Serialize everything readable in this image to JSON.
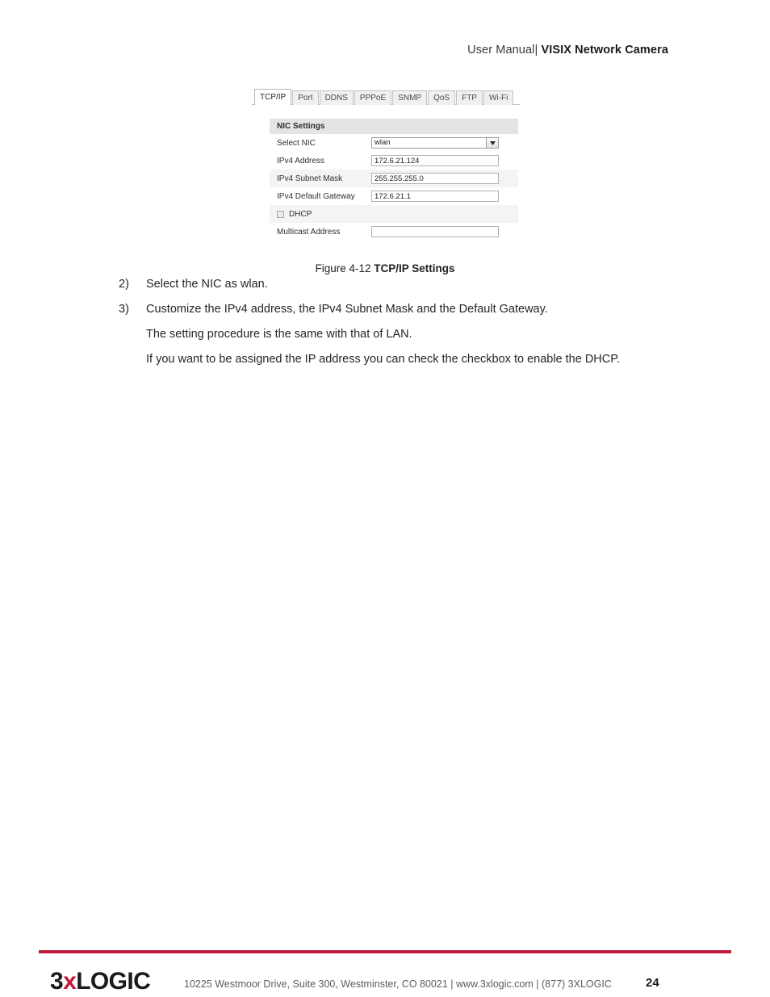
{
  "header": {
    "manual_label": "User Manual|",
    "product": "VISIX Network Camera"
  },
  "screenshot": {
    "tabs": [
      {
        "label": "TCP/IP",
        "active": true
      },
      {
        "label": "Port",
        "active": false
      },
      {
        "label": "DDNS",
        "active": false
      },
      {
        "label": "PPPoE",
        "active": false
      },
      {
        "label": "SNMP",
        "active": false
      },
      {
        "label": "QoS",
        "active": false
      },
      {
        "label": "FTP",
        "active": false
      },
      {
        "label": "Wi-Fi",
        "active": false
      }
    ],
    "panel_title": "NIC Settings",
    "fields": {
      "select_nic": {
        "label": "Select NIC",
        "value": "wlan"
      },
      "ipv4_address": {
        "label": "IPv4 Address",
        "value": "172.6.21.124"
      },
      "ipv4_subnet_mask": {
        "label": "IPv4 Subnet Mask",
        "value": "255.255.255.0"
      },
      "ipv4_default_gateway": {
        "label": "IPv4 Default Gateway",
        "value": "172.6.21.1"
      },
      "dhcp": {
        "label": "DHCP",
        "checked": false
      },
      "multicast_address": {
        "label": "Multicast Address",
        "value": ""
      }
    }
  },
  "figure": {
    "number": "Figure 4-12 ",
    "name": "TCP/IP Settings"
  },
  "steps": [
    {
      "num": "2)",
      "text": "Select the NIC as wlan."
    },
    {
      "num": "3)",
      "text": "Customize the IPv4 address, the IPv4 Subnet Mask and the Default Gateway."
    }
  ],
  "paragraphs": [
    "The setting procedure is the same with that of LAN.",
    "If you want to be assigned the IP address you can check the checkbox to enable the DHCP."
  ],
  "footer": {
    "logo_pre": "3",
    "logo_x": "x",
    "logo_post": "LOGIC",
    "info": "10225 Westmoor Drive, Suite 300, Westminster, CO 80021 | www.3xlogic.com | (877) 3XLOGIC",
    "page": "24",
    "accent_color": "#c01c3c"
  }
}
